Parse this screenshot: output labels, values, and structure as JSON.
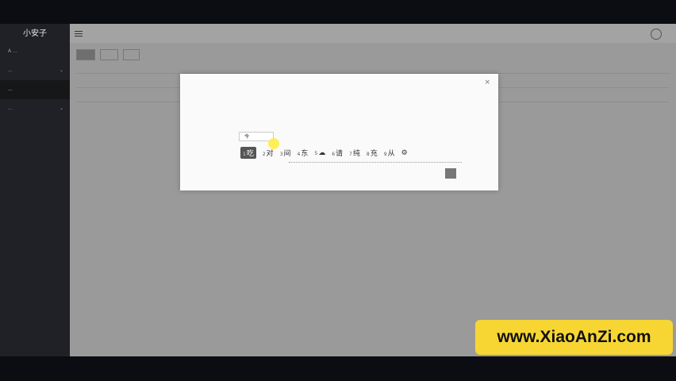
{
  "sidebar": {
    "logo": "小安子",
    "items": [
      {
        "label": "A ..."
      },
      {
        "label": "..."
      },
      {
        "label": "..."
      },
      {
        "label": "..."
      }
    ]
  },
  "dialog": {
    "keyword_value": "今",
    "candidates": [
      {
        "num": "1",
        "char": "吃",
        "selected": true
      },
      {
        "num": "2",
        "char": "对"
      },
      {
        "num": "3",
        "char": "间"
      },
      {
        "num": "4",
        "char": "东"
      },
      {
        "num": "5",
        "char": "☁"
      },
      {
        "num": "6",
        "char": "请"
      },
      {
        "num": "7",
        "char": "纯"
      },
      {
        "num": "8",
        "char": "充"
      },
      {
        "num": "9",
        "char": "从"
      }
    ],
    "settings_icon": "gear-icon",
    "close_icon": "×"
  },
  "watermark": "www.XiaoAnZi.com"
}
